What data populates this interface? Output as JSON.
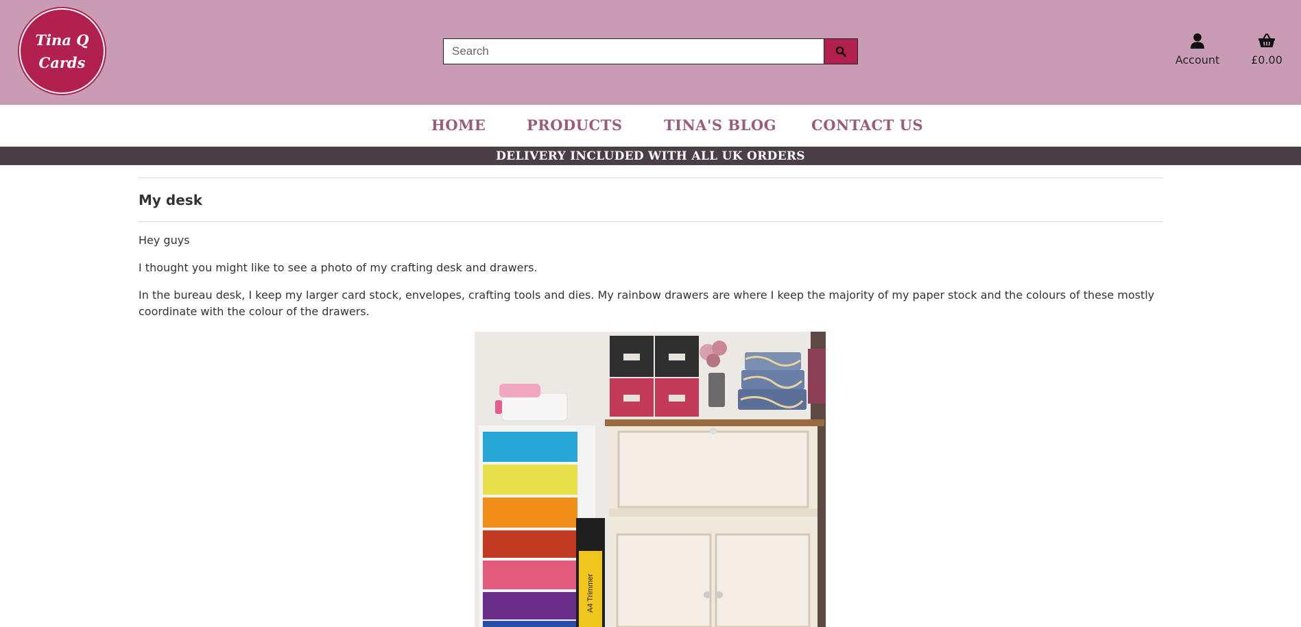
{
  "header": {
    "logo_line1": "Tina Q",
    "logo_line2": "Cards",
    "search_placeholder": "Search",
    "account_label": "Account",
    "basket_total": "£0.00",
    "icons": {
      "search": "search-icon",
      "account": "user-icon",
      "basket": "basket-icon"
    }
  },
  "nav": {
    "items": [
      {
        "label": "HOME"
      },
      {
        "label": "PRODUCTS"
      },
      {
        "label": "TINA'S BLOG"
      },
      {
        "label": "CONTACT US"
      }
    ]
  },
  "banner": {
    "text": "DELIVERY INCLUDED WITH ALL UK ORDERS"
  },
  "post": {
    "title": "My desk",
    "paragraphs": [
      "Hey guys",
      "I thought you might like to see a photo of my crafting desk and drawers.",
      "In the bureau desk, I keep my larger card stock, envelopes, crafting tools and dies. My rainbow drawers are where I keep the majority of my paper stock and the colours of these mostly coordinate with the colour of the drawers."
    ],
    "photo_box_label": "A4 Trimmer"
  },
  "colors": {
    "header_bg": "#c99cb4",
    "brand": "#b2204f",
    "nav_text": "#9a5c7c",
    "banner_bg": "#4b3f47"
  }
}
